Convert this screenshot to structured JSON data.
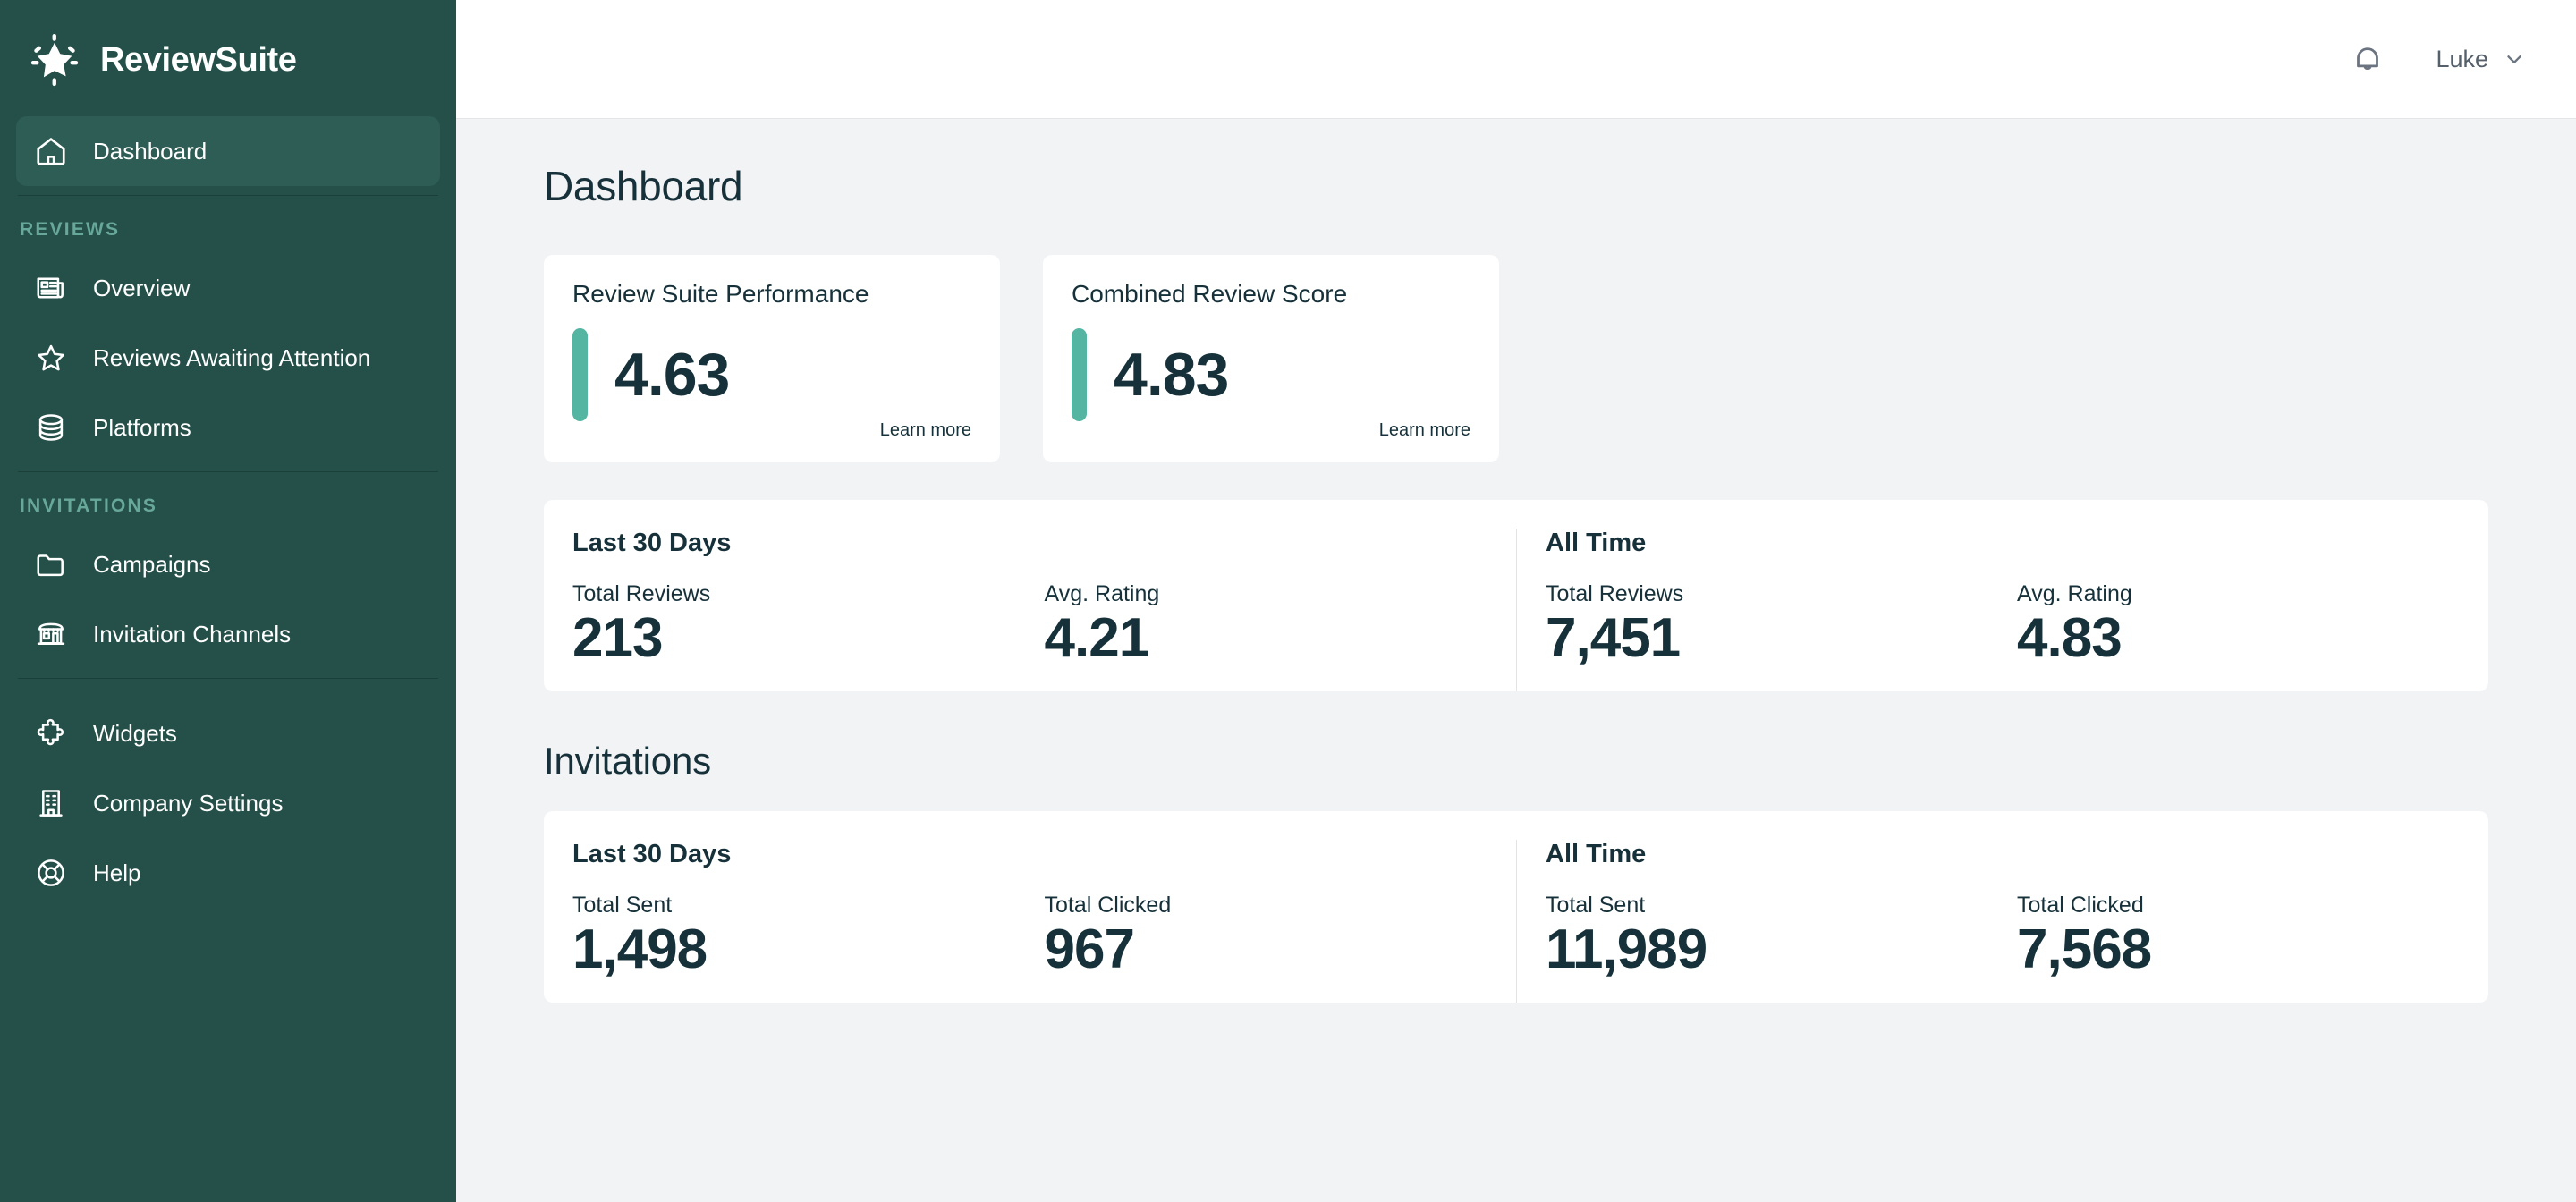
{
  "brand": {
    "name": "ReviewSuite",
    "logo_icon": "sparkle-star-icon"
  },
  "sidebar": {
    "primary": [
      {
        "label": "Dashboard",
        "icon": "home-icon",
        "active": true
      }
    ],
    "sections": [
      {
        "label": "REVIEWS",
        "items": [
          {
            "label": "Overview",
            "icon": "newspaper-icon"
          },
          {
            "label": "Reviews Awaiting Attention",
            "icon": "star-icon"
          },
          {
            "label": "Platforms",
            "icon": "database-icon"
          }
        ]
      },
      {
        "label": "INVITATIONS",
        "items": [
          {
            "label": "Campaigns",
            "icon": "folder-icon"
          },
          {
            "label": "Invitation Channels",
            "icon": "storefront-icon"
          }
        ]
      }
    ],
    "footer_items": [
      {
        "label": "Widgets",
        "icon": "puzzle-icon"
      },
      {
        "label": "Company Settings",
        "icon": "building-icon"
      },
      {
        "label": "Help",
        "icon": "lifebuoy-icon"
      }
    ]
  },
  "topbar": {
    "notifications_icon": "bell-icon",
    "user_name": "Luke",
    "chevron_icon": "chevron-down-icon"
  },
  "page": {
    "title": "Dashboard",
    "invitations_title": "Invitations"
  },
  "score_cards": [
    {
      "label": "Review Suite Performance",
      "value": "4.63",
      "link": "Learn more"
    },
    {
      "label": "Combined Review Score",
      "value": "4.83",
      "link": "Learn more"
    }
  ],
  "reviews_stats": {
    "left": {
      "period": "Last 30 Days",
      "metrics": [
        {
          "label": "Total Reviews",
          "value": "213"
        },
        {
          "label": "Avg. Rating",
          "value": "4.21"
        }
      ]
    },
    "right": {
      "period": "All Time",
      "metrics": [
        {
          "label": "Total Reviews",
          "value": "7,451"
        },
        {
          "label": "Avg. Rating",
          "value": "4.83"
        }
      ]
    }
  },
  "invitations_stats": {
    "left": {
      "period": "Last 30 Days",
      "metrics": [
        {
          "label": "Total Sent",
          "value": "1,498"
        },
        {
          "label": "Total Clicked",
          "value": "967"
        }
      ]
    },
    "right": {
      "period": "All Time",
      "metrics": [
        {
          "label": "Total Sent",
          "value": "11,989"
        },
        {
          "label": "Total Clicked",
          "value": "7,568"
        }
      ]
    }
  },
  "colors": {
    "sidebar_bg": "#245049",
    "sidebar_active": "#2e5d55",
    "accent_teal": "#54b5a2",
    "text_dark": "#17313a",
    "page_bg": "#f2f3f5",
    "section_label": "#67a89a"
  }
}
